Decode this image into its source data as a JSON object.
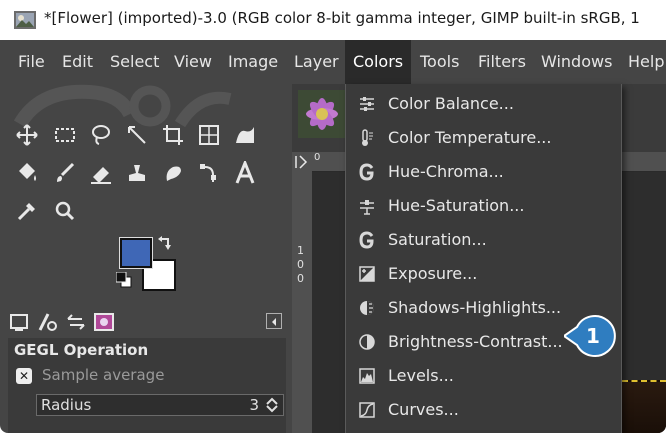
{
  "window": {
    "title": "*[Flower] (imported)-3.0 (RGB color 8-bit gamma integer, GIMP built-in sRGB, 1"
  },
  "menubar": {
    "items": [
      "File",
      "Edit",
      "Select",
      "View",
      "Image",
      "Layer",
      "Colors",
      "Tools",
      "Filters",
      "Windows",
      "Help"
    ],
    "active": "Colors"
  },
  "colors_menu": {
    "items": [
      {
        "label": "Color Balance...",
        "icon": "color-balance-icon"
      },
      {
        "label": "Color Temperature...",
        "icon": "thermometer-icon"
      },
      {
        "label": "Hue-Chroma...",
        "icon": "gegl-icon"
      },
      {
        "label": "Hue-Saturation...",
        "icon": "hue-saturation-icon"
      },
      {
        "label": "Saturation...",
        "icon": "gegl-icon"
      },
      {
        "label": "Exposure...",
        "icon": "exposure-icon"
      },
      {
        "label": "Shadows-Highlights...",
        "icon": "shadows-highlights-icon"
      },
      {
        "label": "Brightness-Contrast...",
        "icon": "brightness-contrast-icon"
      },
      {
        "label": "Levels...",
        "icon": "levels-icon"
      },
      {
        "label": "Curves...",
        "icon": "curves-icon"
      }
    ]
  },
  "tool_options": {
    "panel_title": "GEGL Operation",
    "sample_label": "Sample average",
    "radius_label": "Radius",
    "radius_value": "3"
  },
  "colors": {
    "foreground": "#3f67b6",
    "background": "#ffffff",
    "menu_bg": "#3a3a3a",
    "menubar_bg": "#454545",
    "callout": "#2f7dc0"
  },
  "callout": {
    "number": "1"
  },
  "ruler": {
    "left_marks": [
      "1",
      "0",
      "0"
    ],
    "top_mark": "0"
  }
}
